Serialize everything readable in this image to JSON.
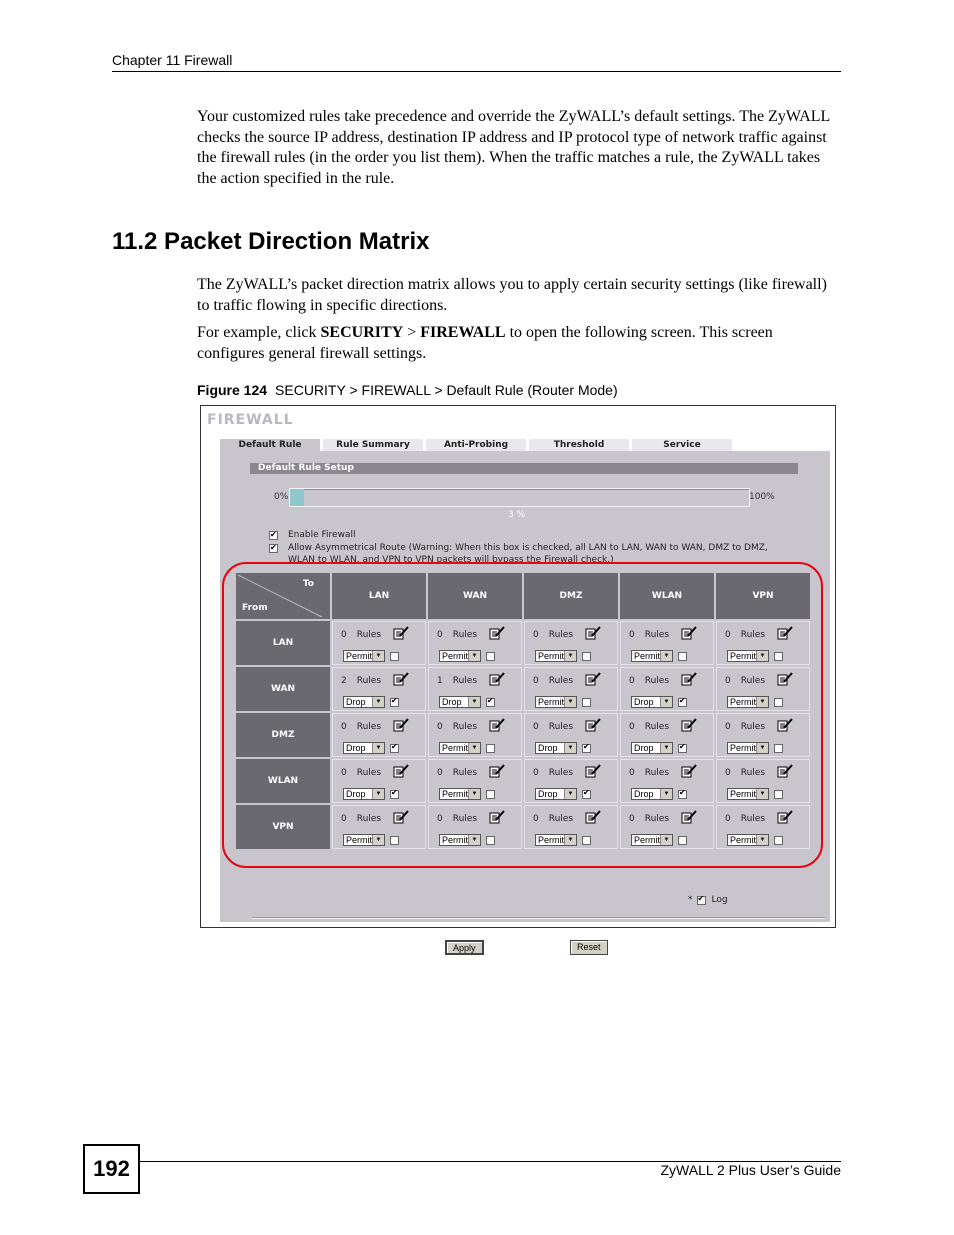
{
  "header": {
    "chapter": "Chapter 11 Firewall"
  },
  "body": {
    "intro": "Your customized rules take precedence and override the ZyWALL’s default settings. The ZyWALL checks the source IP address, destination IP address and IP protocol type of network traffic against the firewall rules (in the order you list them). When the traffic matches a rule, the ZyWALL takes the action specified in the rule.",
    "section_title": "11.2  Packet Direction Matrix",
    "para1": "The ZyWALL’s packet direction matrix allows you to apply certain security settings (like firewall) to traffic flowing in specific directions.",
    "para2_pre": "For example, click ",
    "para2_b1": "SECURITY",
    "para2_mid": " > ",
    "para2_b2": "FIREWALL",
    "para2_post": " to open the following screen. This screen configures general firewall settings.",
    "figure_label": "Figure 124",
    "figure_caption": "SECURITY > FIREWALL > Default Rule (Router Mode)"
  },
  "screen": {
    "title": "FIREWALL",
    "tabs": [
      "Default Rule",
      "Rule Summary",
      "Anti-Probing",
      "Threshold",
      "Service"
    ],
    "active_tab": "Default Rule",
    "section": "Default Rule Setup",
    "progress": {
      "min_label": "0%",
      "max_label": "100%",
      "value_label": "3 %",
      "percent": 3
    },
    "enable_firewall": {
      "label": "Enable Firewall",
      "checked": true
    },
    "asymmetric": {
      "label": "Allow Asymmetrical Route (Warning: When this box is checked, all LAN to LAN, WAN to WAN, DMZ to DMZ, WLAN to WLAN, and VPN to VPN packets will bypass the Firewall check.)",
      "checked": true
    },
    "matrix": {
      "corner_to": "To",
      "corner_from": "From",
      "columns": [
        "LAN",
        "WAN",
        "DMZ",
        "WLAN",
        "VPN"
      ],
      "rules_label": "Rules",
      "rows": [
        {
          "from": "LAN",
          "cells": [
            {
              "rules": "0",
              "action": "Permit",
              "log": false
            },
            {
              "rules": "0",
              "action": "Permit",
              "log": false
            },
            {
              "rules": "0",
              "action": "Permit",
              "log": false
            },
            {
              "rules": "0",
              "action": "Permit",
              "log": false
            },
            {
              "rules": "0",
              "action": "Permit",
              "log": false
            }
          ]
        },
        {
          "from": "WAN",
          "cells": [
            {
              "rules": "2",
              "action": "Drop",
              "log": true
            },
            {
              "rules": "1",
              "action": "Drop",
              "log": true
            },
            {
              "rules": "0",
              "action": "Permit",
              "log": false
            },
            {
              "rules": "0",
              "action": "Drop",
              "log": true
            },
            {
              "rules": "0",
              "action": "Permit",
              "log": false
            }
          ]
        },
        {
          "from": "DMZ",
          "cells": [
            {
              "rules": "0",
              "action": "Drop",
              "log": true
            },
            {
              "rules": "0",
              "action": "Permit",
              "log": false
            },
            {
              "rules": "0",
              "action": "Drop",
              "log": true
            },
            {
              "rules": "0",
              "action": "Drop",
              "log": true
            },
            {
              "rules": "0",
              "action": "Permit",
              "log": false
            }
          ]
        },
        {
          "from": "WLAN",
          "cells": [
            {
              "rules": "0",
              "action": "Drop",
              "log": true
            },
            {
              "rules": "0",
              "action": "Permit",
              "log": false
            },
            {
              "rules": "0",
              "action": "Drop",
              "log": true
            },
            {
              "rules": "0",
              "action": "Drop",
              "log": true
            },
            {
              "rules": "0",
              "action": "Permit",
              "log": false
            }
          ]
        },
        {
          "from": "VPN",
          "cells": [
            {
              "rules": "0",
              "action": "Permit",
              "log": false
            },
            {
              "rules": "0",
              "action": "Permit",
              "log": false
            },
            {
              "rules": "0",
              "action": "Permit",
              "log": false
            },
            {
              "rules": "0",
              "action": "Permit",
              "log": false
            },
            {
              "rules": "0",
              "action": "Permit",
              "log": false
            }
          ]
        }
      ]
    },
    "log": {
      "prefix": "*",
      "label": "Log",
      "checked": true
    },
    "apply_label": "Apply",
    "reset_label": "Reset",
    "highlight_color": "#e30613"
  },
  "footer": {
    "page_number": "192",
    "guide_title": "ZyWALL 2 Plus User’s Guide"
  }
}
